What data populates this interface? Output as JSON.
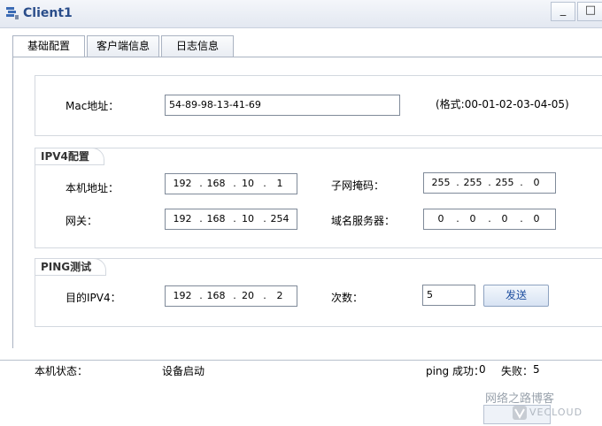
{
  "window": {
    "title": "Client1",
    "min_glyph": "_",
    "max_glyph": "□"
  },
  "tabs": [
    {
      "label": "基础配置"
    },
    {
      "label": "客户端信息"
    },
    {
      "label": "日志信息"
    }
  ],
  "mac": {
    "label": "Mac地址：",
    "value": "54-89-98-13-41-69",
    "hint": "(格式:00-01-02-03-04-05)"
  },
  "ipv4": {
    "title": "IPV4配置",
    "local_label": "本机地址：",
    "local_ip": [
      "192",
      "168",
      "10",
      "1"
    ],
    "mask_label": "子网掩码：",
    "mask": [
      "255",
      "255",
      "255",
      "0"
    ],
    "gw_label": "网关：",
    "gw": [
      "192",
      "168",
      "10",
      "254"
    ],
    "dns_label": "域名服务器：",
    "dns": [
      "0",
      "0",
      "0",
      "0"
    ]
  },
  "ping": {
    "title": "PING测试",
    "dest_label": "目的IPV4：",
    "dest_ip": [
      "192",
      "168",
      "20",
      "2"
    ],
    "count_label": "次数：",
    "count": "5",
    "send_label": "发送"
  },
  "status": {
    "label": "本机状态：",
    "value": "设备启动",
    "success_label": "ping 成功：",
    "success": "0",
    "fail_label": "失败：",
    "fail": "5"
  },
  "watermark": {
    "text": "网络之路博客",
    "logo_text": "VECLOUD"
  },
  "icons": {
    "app": "network-host-icon"
  }
}
